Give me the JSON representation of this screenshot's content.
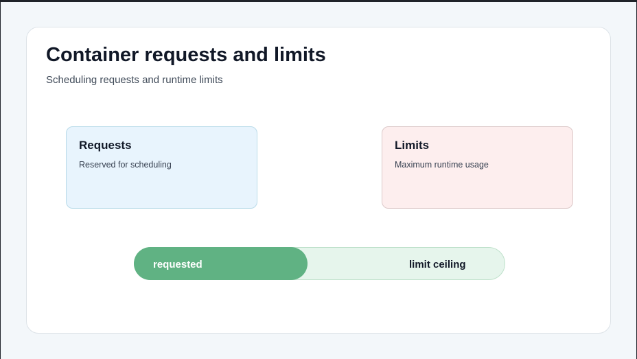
{
  "title": "Container requests and limits",
  "subtitle": "Scheduling requests and runtime limits",
  "requests": {
    "title": "Requests",
    "description": "Reserved for scheduling",
    "color": "#e8f4fd"
  },
  "limits": {
    "title": "Limits",
    "description": "Maximum runtime usage",
    "color": "#fdeeee"
  },
  "usage_bar": {
    "requested_label": "requested",
    "limit_label": "limit ceiling",
    "requested_fraction": 0.47,
    "fill_color": "#60b283",
    "track_color": "#e6f5ec"
  }
}
